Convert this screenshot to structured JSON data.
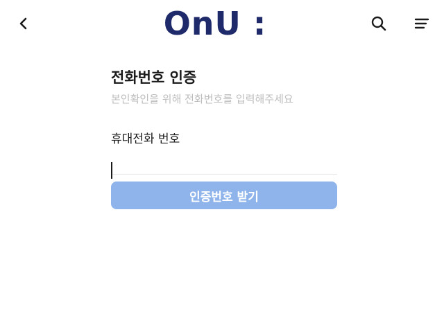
{
  "header": {
    "logo_text": "OnU :",
    "back_icon": "chevron-left-icon",
    "search_icon": "search-icon",
    "menu_icon": "menu-icon"
  },
  "page": {
    "title": "전화번호 인증",
    "subtitle": "본인확인을 위해 전화번호를 입력해주세요"
  },
  "form": {
    "phone_label": "휴대전화 번호",
    "phone_value": "",
    "submit_label": "인증번호 받기"
  },
  "colors": {
    "brand": "#1f2a6b",
    "button": "#8fb4ec",
    "subtitle": "#bdbdbd"
  }
}
